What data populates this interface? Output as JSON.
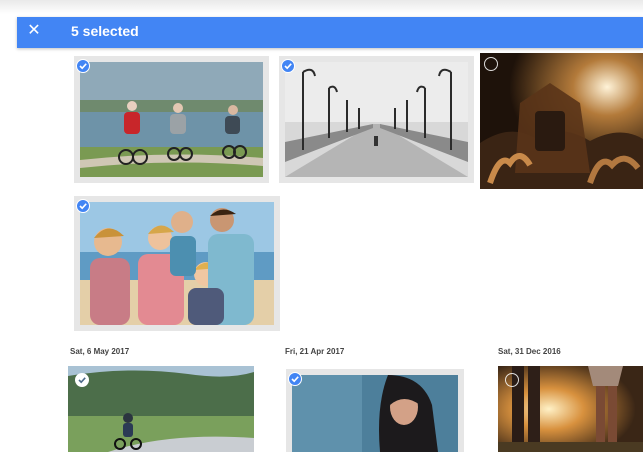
{
  "toolbar": {
    "close_icon": "close-icon",
    "close_glyph": "✕",
    "selection_label": "5 selected",
    "color": "#4285f4"
  },
  "date_groups": [
    {
      "label": "Sat, 6 May 2017"
    },
    {
      "label": "Fri, 21 Apr 2017"
    },
    {
      "label": "Sat, 31 Dec 2016"
    }
  ],
  "photos": [
    {
      "name": "cyclists-photo",
      "selected": true
    },
    {
      "name": "pier-photo",
      "selected": true
    },
    {
      "name": "concert-crowd-photo",
      "selected": false
    },
    {
      "name": "family-beach-photo",
      "selected": true
    },
    {
      "name": "child-bike-park-photo",
      "selected": false
    },
    {
      "name": "woman-portrait-photo",
      "selected": true
    },
    {
      "name": "sunset-legs-photo",
      "selected": false
    }
  ]
}
